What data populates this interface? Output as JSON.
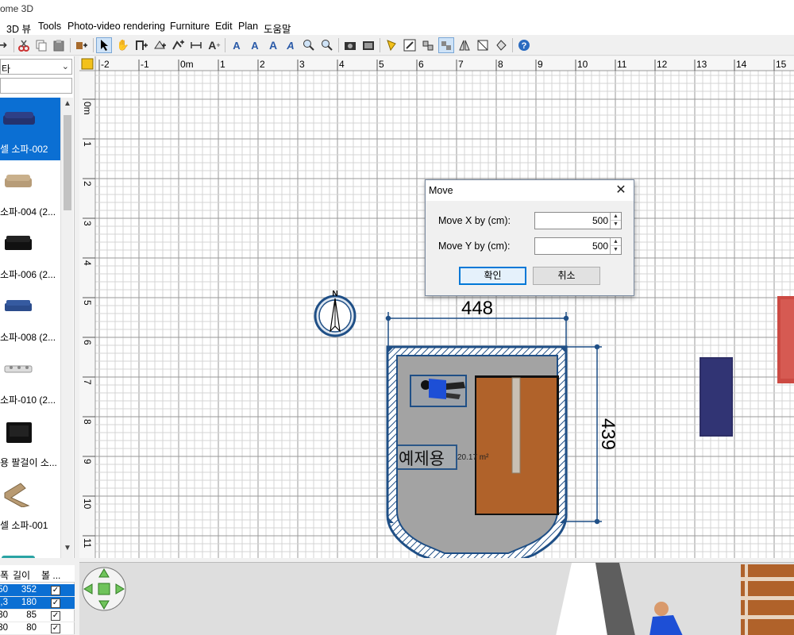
{
  "app": {
    "title": "ome 3D"
  },
  "menu": [
    "3D 뷰",
    "Tools",
    "Photo-video rendering",
    "Furniture",
    "Edit",
    "Plan",
    "도움말"
  ],
  "catalog": {
    "category": "타",
    "items": [
      {
        "label": "셀 소파-002",
        "selected": true
      },
      {
        "label": "소파-004 (2...",
        "selected": false
      },
      {
        "label": "소파-006 (2...",
        "selected": false
      },
      {
        "label": "소파-008 (2...",
        "selected": false
      },
      {
        "label": "소파-010 (2...",
        "selected": false
      },
      {
        "label": "용 팔걸이 소...",
        "selected": false
      },
      {
        "label": "셀 소파-001",
        "selected": false
      }
    ]
  },
  "furniture_table": {
    "headers": [
      "폭",
      "길이",
      "볼 ..."
    ],
    "rows": [
      {
        "width": "50",
        "depth": "352",
        "visible": true,
        "selected": true
      },
      {
        "width": "1,3",
        "depth": "180",
        "visible": true,
        "selected": true
      },
      {
        "width": "30",
        "depth": "85",
        "visible": true,
        "selected": false
      },
      {
        "width": "30",
        "depth": "80",
        "visible": true,
        "selected": false
      }
    ]
  },
  "plan": {
    "ruler_h": [
      "-2",
      "-1",
      "0m",
      "1",
      "2",
      "3",
      "4",
      "5",
      "6",
      "7",
      "8",
      "9",
      "10",
      "11",
      "12",
      "13",
      "14",
      "15"
    ],
    "ruler_v": [
      "0m",
      "1",
      "2",
      "3",
      "4",
      "5",
      "6",
      "7",
      "8",
      "9",
      "10",
      "11"
    ],
    "dimension_width": "448",
    "dimension_depth": "439",
    "room_name": "예제용",
    "room_area": "20.17 m²",
    "compass_label": "N"
  },
  "dialog": {
    "title": "Move",
    "move_x_label": "Move X by (cm):",
    "move_x_value": "500",
    "move_y_label": "Move Y by (cm):",
    "move_y_value": "500",
    "ok_label": "확인",
    "cancel_label": "취소"
  },
  "colors": {
    "selection": "#0b6fd3",
    "wall": "#1f4f86",
    "floor_wood": "#b0622a",
    "room_floor": "#a3a3a3",
    "sofa_navy": "#2d2e66",
    "red_furniture": "#cc4a43"
  }
}
